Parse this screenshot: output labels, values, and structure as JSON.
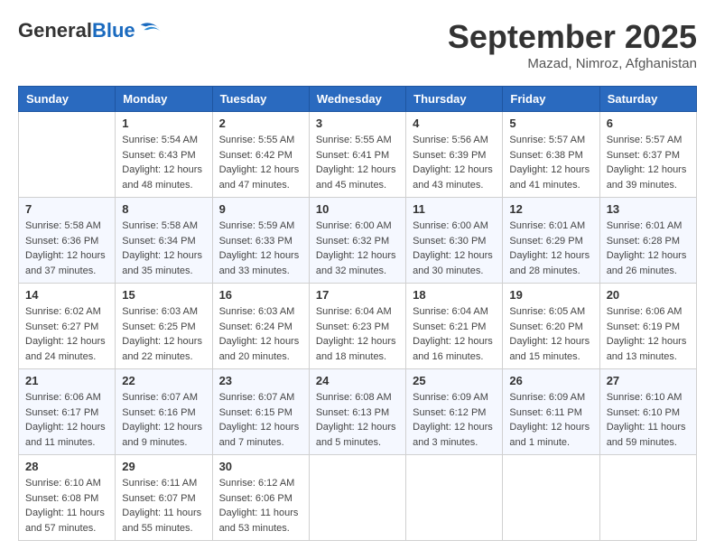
{
  "header": {
    "logo_general": "General",
    "logo_blue": "Blue",
    "month_title": "September 2025",
    "location": "Mazad, Nimroz, Afghanistan"
  },
  "days_of_week": [
    "Sunday",
    "Monday",
    "Tuesday",
    "Wednesday",
    "Thursday",
    "Friday",
    "Saturday"
  ],
  "weeks": [
    [
      {
        "day": "",
        "info": ""
      },
      {
        "day": "1",
        "info": "Sunrise: 5:54 AM\nSunset: 6:43 PM\nDaylight: 12 hours\nand 48 minutes."
      },
      {
        "day": "2",
        "info": "Sunrise: 5:55 AM\nSunset: 6:42 PM\nDaylight: 12 hours\nand 47 minutes."
      },
      {
        "day": "3",
        "info": "Sunrise: 5:55 AM\nSunset: 6:41 PM\nDaylight: 12 hours\nand 45 minutes."
      },
      {
        "day": "4",
        "info": "Sunrise: 5:56 AM\nSunset: 6:39 PM\nDaylight: 12 hours\nand 43 minutes."
      },
      {
        "day": "5",
        "info": "Sunrise: 5:57 AM\nSunset: 6:38 PM\nDaylight: 12 hours\nand 41 minutes."
      },
      {
        "day": "6",
        "info": "Sunrise: 5:57 AM\nSunset: 6:37 PM\nDaylight: 12 hours\nand 39 minutes."
      }
    ],
    [
      {
        "day": "7",
        "info": "Sunrise: 5:58 AM\nSunset: 6:36 PM\nDaylight: 12 hours\nand 37 minutes."
      },
      {
        "day": "8",
        "info": "Sunrise: 5:58 AM\nSunset: 6:34 PM\nDaylight: 12 hours\nand 35 minutes."
      },
      {
        "day": "9",
        "info": "Sunrise: 5:59 AM\nSunset: 6:33 PM\nDaylight: 12 hours\nand 33 minutes."
      },
      {
        "day": "10",
        "info": "Sunrise: 6:00 AM\nSunset: 6:32 PM\nDaylight: 12 hours\nand 32 minutes."
      },
      {
        "day": "11",
        "info": "Sunrise: 6:00 AM\nSunset: 6:30 PM\nDaylight: 12 hours\nand 30 minutes."
      },
      {
        "day": "12",
        "info": "Sunrise: 6:01 AM\nSunset: 6:29 PM\nDaylight: 12 hours\nand 28 minutes."
      },
      {
        "day": "13",
        "info": "Sunrise: 6:01 AM\nSunset: 6:28 PM\nDaylight: 12 hours\nand 26 minutes."
      }
    ],
    [
      {
        "day": "14",
        "info": "Sunrise: 6:02 AM\nSunset: 6:27 PM\nDaylight: 12 hours\nand 24 minutes."
      },
      {
        "day": "15",
        "info": "Sunrise: 6:03 AM\nSunset: 6:25 PM\nDaylight: 12 hours\nand 22 minutes."
      },
      {
        "day": "16",
        "info": "Sunrise: 6:03 AM\nSunset: 6:24 PM\nDaylight: 12 hours\nand 20 minutes."
      },
      {
        "day": "17",
        "info": "Sunrise: 6:04 AM\nSunset: 6:23 PM\nDaylight: 12 hours\nand 18 minutes."
      },
      {
        "day": "18",
        "info": "Sunrise: 6:04 AM\nSunset: 6:21 PM\nDaylight: 12 hours\nand 16 minutes."
      },
      {
        "day": "19",
        "info": "Sunrise: 6:05 AM\nSunset: 6:20 PM\nDaylight: 12 hours\nand 15 minutes."
      },
      {
        "day": "20",
        "info": "Sunrise: 6:06 AM\nSunset: 6:19 PM\nDaylight: 12 hours\nand 13 minutes."
      }
    ],
    [
      {
        "day": "21",
        "info": "Sunrise: 6:06 AM\nSunset: 6:17 PM\nDaylight: 12 hours\nand 11 minutes."
      },
      {
        "day": "22",
        "info": "Sunrise: 6:07 AM\nSunset: 6:16 PM\nDaylight: 12 hours\nand 9 minutes."
      },
      {
        "day": "23",
        "info": "Sunrise: 6:07 AM\nSunset: 6:15 PM\nDaylight: 12 hours\nand 7 minutes."
      },
      {
        "day": "24",
        "info": "Sunrise: 6:08 AM\nSunset: 6:13 PM\nDaylight: 12 hours\nand 5 minutes."
      },
      {
        "day": "25",
        "info": "Sunrise: 6:09 AM\nSunset: 6:12 PM\nDaylight: 12 hours\nand 3 minutes."
      },
      {
        "day": "26",
        "info": "Sunrise: 6:09 AM\nSunset: 6:11 PM\nDaylight: 12 hours\nand 1 minute."
      },
      {
        "day": "27",
        "info": "Sunrise: 6:10 AM\nSunset: 6:10 PM\nDaylight: 11 hours\nand 59 minutes."
      }
    ],
    [
      {
        "day": "28",
        "info": "Sunrise: 6:10 AM\nSunset: 6:08 PM\nDaylight: 11 hours\nand 57 minutes."
      },
      {
        "day": "29",
        "info": "Sunrise: 6:11 AM\nSunset: 6:07 PM\nDaylight: 11 hours\nand 55 minutes."
      },
      {
        "day": "30",
        "info": "Sunrise: 6:12 AM\nSunset: 6:06 PM\nDaylight: 11 hours\nand 53 minutes."
      },
      {
        "day": "",
        "info": ""
      },
      {
        "day": "",
        "info": ""
      },
      {
        "day": "",
        "info": ""
      },
      {
        "day": "",
        "info": ""
      }
    ]
  ]
}
